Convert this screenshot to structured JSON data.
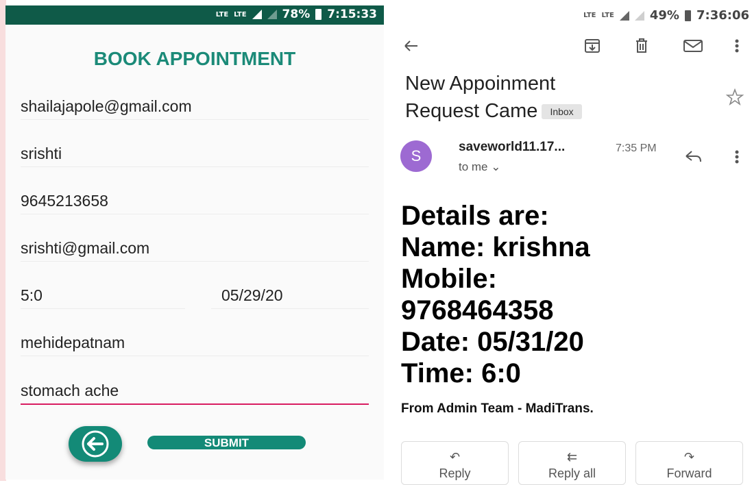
{
  "left_screen": {
    "status_bar": {
      "network1": "LTE",
      "network2": "LTE",
      "battery": "78%",
      "time": "7:15:33"
    },
    "title": "BOOK APPOINTMENT",
    "fields": {
      "email": "shailajapole@gmail.com",
      "name": "srishti",
      "phone": "9645213658",
      "patient_email": "srishti@gmail.com",
      "time": "5:0",
      "date": "05/29/20",
      "location": "mehidepatnam",
      "problem": "stomach ache"
    },
    "submit_label": "SUBMIT",
    "icons": {
      "back": "arrow-left-icon"
    }
  },
  "right_screen": {
    "status_bar": {
      "network1": "LTE",
      "network2": "LTE",
      "battery": "49%",
      "time": "7:36:06"
    },
    "toolbar_icons": [
      "arrow-left-icon",
      "archive-icon",
      "trash-icon",
      "mail-icon",
      "more-vert-icon"
    ],
    "subject_line1": "New Appoinment",
    "subject_line2": "Request Came",
    "label_chip": "Inbox",
    "avatar_letter": "S",
    "avatar_color": "#9d6ad2",
    "sender": "saveworld11.17...",
    "sent_time": "7:35 PM",
    "recipient": "to me",
    "body": {
      "line1": "Details are:",
      "line2": "Name: krishna",
      "line3": "Mobile:",
      "line4": "9768464358",
      "line5": "Date: 05/31/20",
      "line6": "Time: 6:0"
    },
    "from_team": "From Admin Team - MadiTrans.",
    "actions": {
      "reply": "Reply",
      "reply_all": "Reply all",
      "forward": "Forward"
    }
  },
  "colors": {
    "accent_teal": "#138a77",
    "status_bar_dark": "#0f5a48",
    "active_underline": "#d81b60"
  }
}
